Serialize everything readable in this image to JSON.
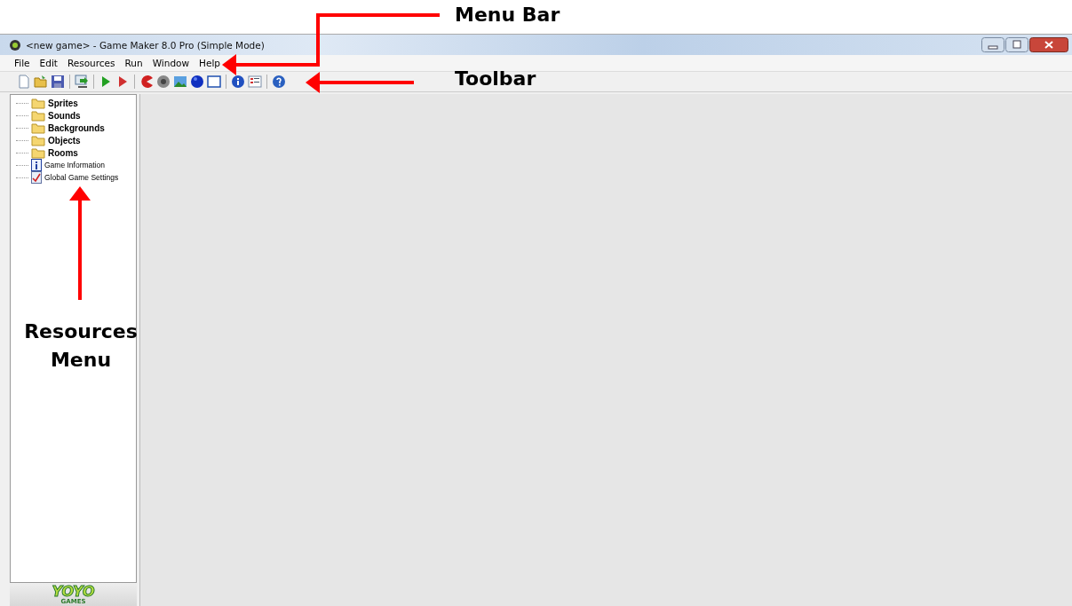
{
  "window": {
    "title": "<new game> - Game Maker 8.0 Pro (Simple Mode)"
  },
  "menu_bar": [
    "File",
    "Edit",
    "Resources",
    "Run",
    "Window",
    "Help"
  ],
  "resource_tree": [
    {
      "label": "Sprites",
      "kind": "folder"
    },
    {
      "label": "Sounds",
      "kind": "folder"
    },
    {
      "label": "Backgrounds",
      "kind": "folder"
    },
    {
      "label": "Objects",
      "kind": "folder"
    },
    {
      "label": "Rooms",
      "kind": "folder"
    },
    {
      "label": "Game Information",
      "kind": "info"
    },
    {
      "label": "Global Game Settings",
      "kind": "settings"
    }
  ],
  "logo": {
    "name": "YOYO",
    "subtitle": "GAMES"
  },
  "annotations": [
    {
      "label": "Menu Bar",
      "kind": "menu"
    },
    {
      "label": "Toolbar",
      "kind": "toolbar"
    },
    {
      "label": "Resources Menu",
      "kind": "tree"
    }
  ]
}
